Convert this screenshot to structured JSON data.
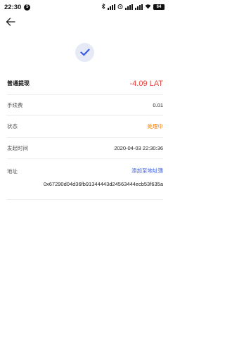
{
  "status_bar": {
    "time": "22:30",
    "notification_badge": "5",
    "battery": "64"
  },
  "header": {
    "back_icon": "arrow-left-icon"
  },
  "result": {
    "icon": "checkmark-icon",
    "accent_color": "#3a5be0"
  },
  "details": {
    "type_label": "普通提现",
    "amount": "-4.09 LAT",
    "fee_label": "手续费",
    "fee_value": "0.01",
    "status_label": "状态",
    "status_value": "处理中",
    "time_label": "发起时间",
    "time_value": "2020-04-03 22:30:36",
    "address_label": "地址",
    "add_to_book_link": "添加至地址簿",
    "address_value": "0x67290d04d36fb91344443d24563444ecb53f635a"
  },
  "colors": {
    "amount": "#e8413b",
    "status": "#f07800",
    "link": "#3a5be0"
  }
}
